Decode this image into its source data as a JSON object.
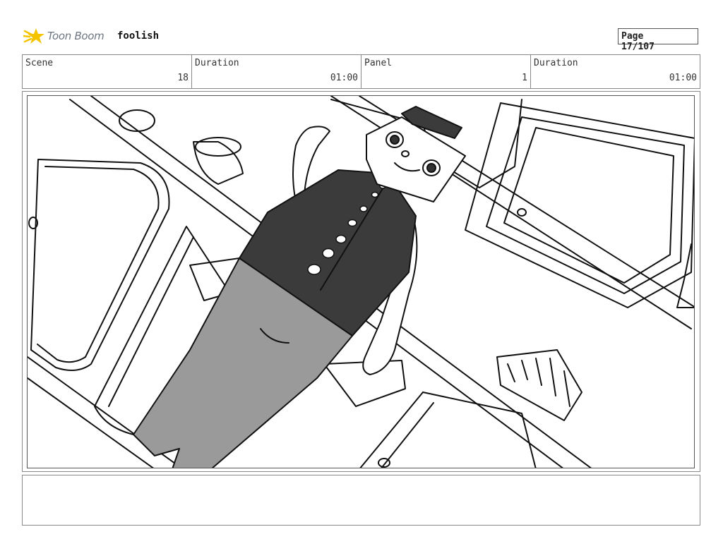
{
  "header": {
    "logo_text": "Toon Boom",
    "logo_icon": "toon-boom-star-icon",
    "project_name": "foolish",
    "page_label": "Page",
    "page_value": "17/107"
  },
  "info": {
    "scene_label": "Scene",
    "scene_value": "18",
    "duration_label": "Duration",
    "duration_value": "01:00",
    "panel_label": "Panel",
    "panel_value": "1",
    "panel_duration_label": "Duration",
    "panel_duration_value": "01:00"
  },
  "colors": {
    "logo_yellow": "#f5c400",
    "vest": "#3b3b3b",
    "pants": "#9a9a9a"
  },
  "notes": ""
}
